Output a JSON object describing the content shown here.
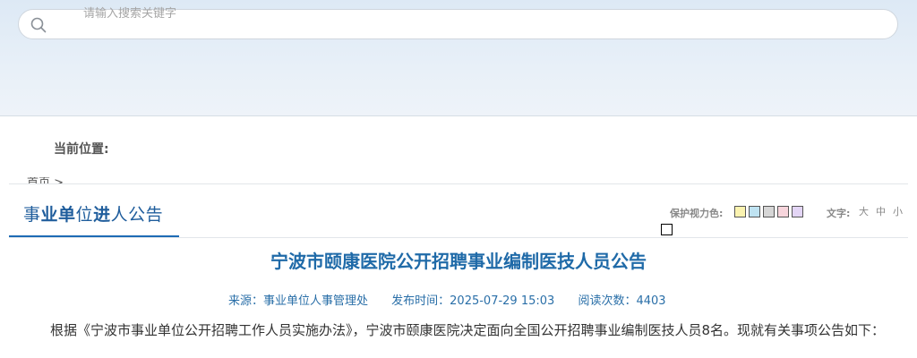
{
  "search": {
    "placeholder": "请输入搜索关键字"
  },
  "location": {
    "label": "当前位置:",
    "crumb_partial": "首页 >"
  },
  "section": {
    "title_parts": [
      "事",
      "业",
      "单",
      "位",
      "进",
      "人公告"
    ]
  },
  "tools": {
    "eye_label": "保护视力色:",
    "swatch_colors": [
      "#fbf3b0",
      "#bfe3f2",
      "#d6d6d6",
      "#f7d5dc",
      "#e3d5f5"
    ],
    "font_label": "文字:",
    "font_sizes": [
      "大",
      "中",
      "小"
    ]
  },
  "article": {
    "title": "宁波市颐康医院公开招聘事业编制医技人员公告",
    "source": "来源：事业单位人事管理处",
    "publish_time": "发布时间：2025-07-29 15:03",
    "reads": "阅读次数：4403",
    "body": "根据《宁波市事业单位公开招聘工作人员实施办法》，宁波市颐康医院决定面向全国公开招聘事业编制医技人员8名。现就有关事项公告如下："
  }
}
